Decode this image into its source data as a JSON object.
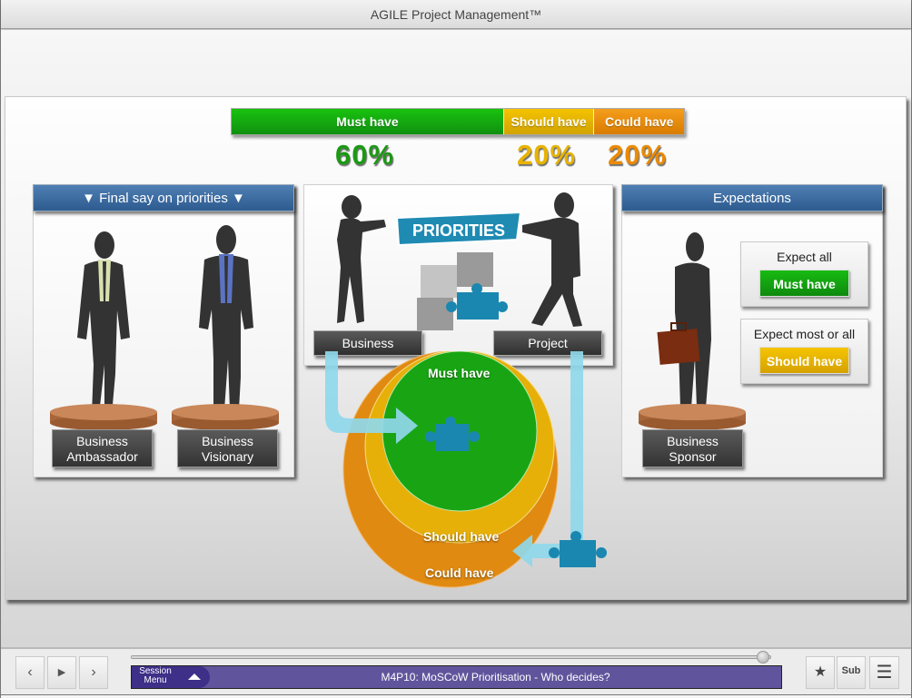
{
  "app": {
    "title": "AGILE Project Management™"
  },
  "moscow_bar": {
    "segments": [
      {
        "label": "Must have",
        "share": 60,
        "color": "#13a80f"
      },
      {
        "label": "Should have",
        "share": 20,
        "color": "#e2b300"
      },
      {
        "label": "Could have",
        "share": 20,
        "color": "#e88a0a"
      }
    ],
    "percentages": {
      "must": "60%",
      "should": "20%",
      "could": "20%"
    }
  },
  "left_panel": {
    "title": "▼ Final say on priorities ▼",
    "roles": [
      {
        "line1": "Business",
        "line2": "Ambassador"
      },
      {
        "line1": "Business",
        "line2": "Visionary"
      }
    ]
  },
  "center_panel": {
    "banner": "PRIORITIES",
    "left_tag": "Business",
    "right_tag": "Project",
    "circles": {
      "must": "Must have",
      "should": "Should have",
      "could": "Could have"
    }
  },
  "right_panel": {
    "title": "Expectations",
    "role": {
      "line1": "Business",
      "line2": "Sponsor"
    },
    "expectations": [
      {
        "text": "Expect all",
        "button": "Must have"
      },
      {
        "text": "Expect most or all",
        "button": "Should have"
      }
    ]
  },
  "bottom": {
    "nav": {
      "prev": "‹",
      "play": "▶",
      "next": "›"
    },
    "session_menu": {
      "line1": "Session",
      "line2": "Menu"
    },
    "session_title": "M4P10: MoSCoW Prioritisation - Who decides?",
    "progress": 0.99,
    "tools": {
      "bookmark": "★",
      "subtitles": "Sub",
      "menu": "☰"
    }
  }
}
